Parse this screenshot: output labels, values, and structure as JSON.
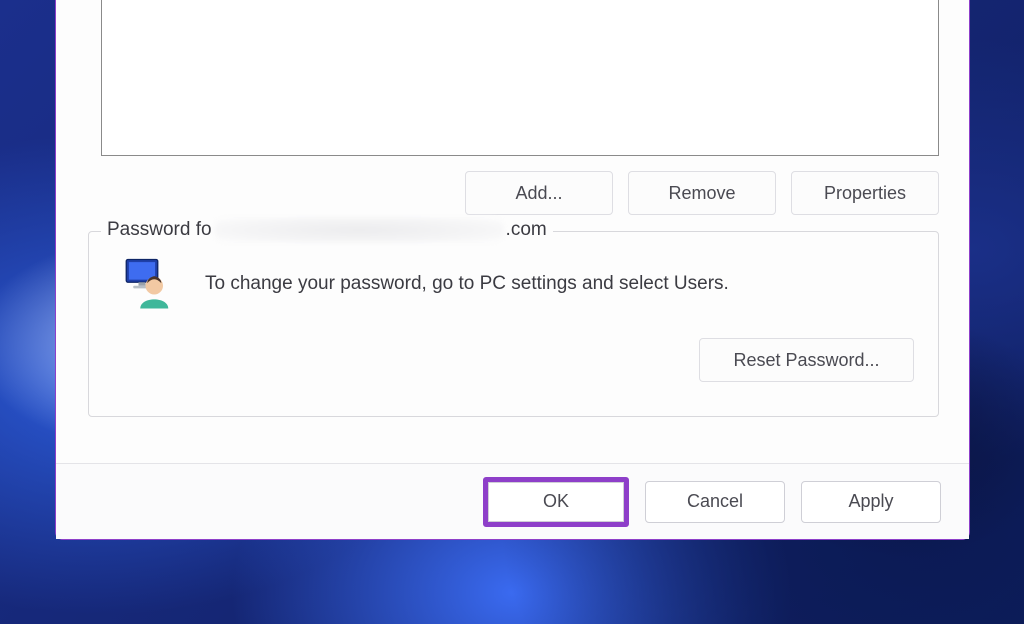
{
  "buttons": {
    "add": "Add...",
    "remove": "Remove",
    "properties": "Properties",
    "reset_password": "Reset Password...",
    "ok": "OK",
    "cancel": "Cancel",
    "apply": "Apply"
  },
  "password_section": {
    "legend_prefix": "Password fo",
    "legend_suffix": ".com",
    "instruction": "To change your password, go to PC settings and select Users."
  },
  "colors": {
    "highlight": "#8e3fc9"
  }
}
